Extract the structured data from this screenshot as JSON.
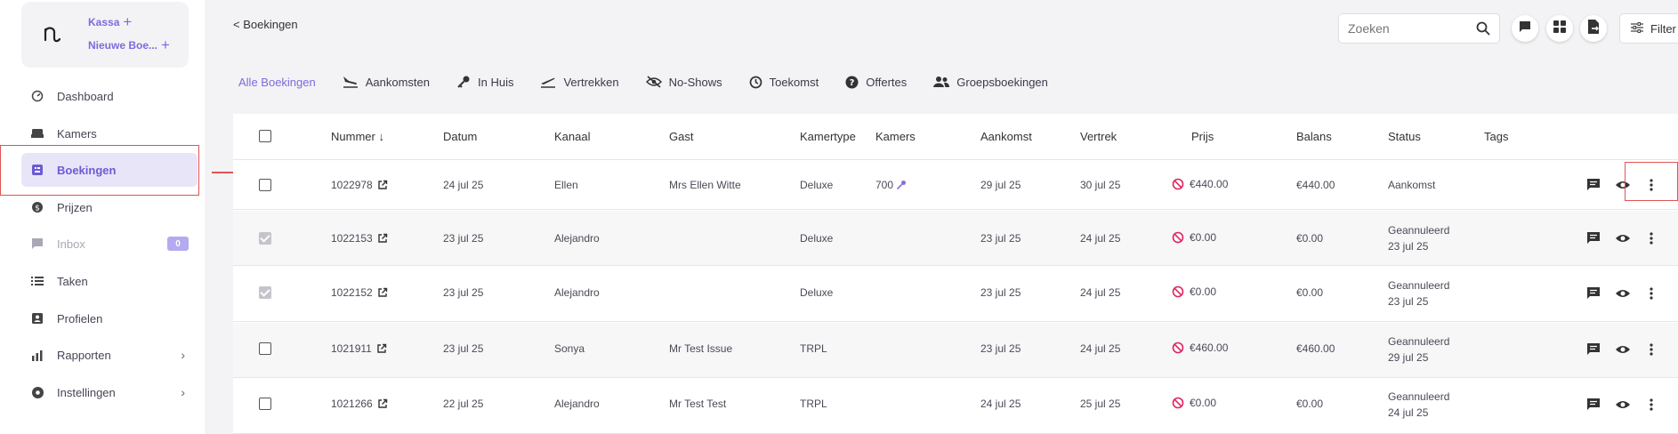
{
  "sidebar": {
    "logo": "n̲",
    "kassa": "Kassa",
    "nieuwe_boeking": "Nieuwe Boe...",
    "items": [
      {
        "label": "Dashboard",
        "icon": "gauge-icon"
      },
      {
        "label": "Kamers",
        "icon": "bed-icon"
      },
      {
        "label": "Boekingen",
        "icon": "booking-icon",
        "active": true
      },
      {
        "label": "Prijzen",
        "icon": "coin-icon"
      },
      {
        "label": "Inbox",
        "icon": "chat-icon",
        "badge": "0",
        "disabled": true
      },
      {
        "label": "Taken",
        "icon": "list-icon"
      },
      {
        "label": "Profielen",
        "icon": "profile-icon"
      },
      {
        "label": "Rapporten",
        "icon": "chart-icon",
        "chevron": "›"
      },
      {
        "label": "Instellingen",
        "icon": "gear-icon",
        "chevron": "›"
      }
    ]
  },
  "header": {
    "back": "< Boekingen",
    "search_placeholder": "Zoeken",
    "filter": "Filter"
  },
  "tabs": [
    {
      "label": "Alle Boekingen",
      "active": true
    },
    {
      "label": "Aankomsten",
      "icon": "plane-landing-icon"
    },
    {
      "label": "In Huis",
      "icon": "key-icon"
    },
    {
      "label": "Vertrekken",
      "icon": "plane-takeoff-icon"
    },
    {
      "label": "No-Shows",
      "icon": "eye-off-icon"
    },
    {
      "label": "Toekomst",
      "icon": "clock-icon"
    },
    {
      "label": "Offertes",
      "icon": "question-icon"
    },
    {
      "label": "Groepsboekingen",
      "icon": "group-icon"
    }
  ],
  "table": {
    "columns": {
      "nummer": "Nummer ↓",
      "datum": "Datum",
      "kanaal": "Kanaal",
      "gast": "Gast",
      "kamertype": "Kamertype",
      "kamers": "Kamers",
      "aankomst": "Aankomst",
      "vertrek": "Vertrek",
      "prijs": "Prijs",
      "balans": "Balans",
      "status": "Status",
      "tags": "Tags"
    },
    "rows": [
      {
        "nummer": "1022978",
        "datum": "24 jul 25",
        "kanaal": "Ellen",
        "gast": "Mrs Ellen Witte",
        "kamertype": "Deluxe",
        "kamers": "700",
        "aankomst": "29 jul 25",
        "vertrek": "30 jul 25",
        "prijs": "€440.00",
        "balans": "€440.00",
        "status": "Aankomst",
        "status_date": "",
        "checked": false
      },
      {
        "nummer": "1022153",
        "datum": "23 jul 25",
        "kanaal": "Alejandro",
        "gast": "",
        "kamertype": "Deluxe",
        "kamers": "",
        "aankomst": "23 jul 25",
        "vertrek": "24 jul 25",
        "prijs": "€0.00",
        "balans": "€0.00",
        "status": "Geannuleerd",
        "status_date": "23 jul 25",
        "checked": true
      },
      {
        "nummer": "1022152",
        "datum": "23 jul 25",
        "kanaal": "Alejandro",
        "gast": "",
        "kamertype": "Deluxe",
        "kamers": "",
        "aankomst": "23 jul 25",
        "vertrek": "24 jul 25",
        "prijs": "€0.00",
        "balans": "€0.00",
        "status": "Geannuleerd",
        "status_date": "23 jul 25",
        "checked": true
      },
      {
        "nummer": "1021911",
        "datum": "23 jul 25",
        "kanaal": "Sonya",
        "gast": "Mr Test Issue",
        "kamertype": "TRPL",
        "kamers": "",
        "aankomst": "23 jul 25",
        "vertrek": "24 jul 25",
        "prijs": "€460.00",
        "balans": "€460.00",
        "status": "Geannuleerd",
        "status_date": "29 jul 25",
        "checked": false
      },
      {
        "nummer": "1021266",
        "datum": "22 jul 25",
        "kanaal": "Alejandro",
        "gast": "Mr Test Test",
        "kamertype": "TRPL",
        "kamers": "",
        "aankomst": "24 jul 25",
        "vertrek": "25 jul 25",
        "prijs": "€0.00",
        "balans": "€0.00",
        "status": "Geannuleerd",
        "status_date": "24 jul 25",
        "checked": false
      }
    ]
  },
  "colors": {
    "accent": "#7c6bdc",
    "active_bg": "#e8e5f8",
    "cancel_icon": "#e0245e",
    "highlight": "#e05454"
  }
}
